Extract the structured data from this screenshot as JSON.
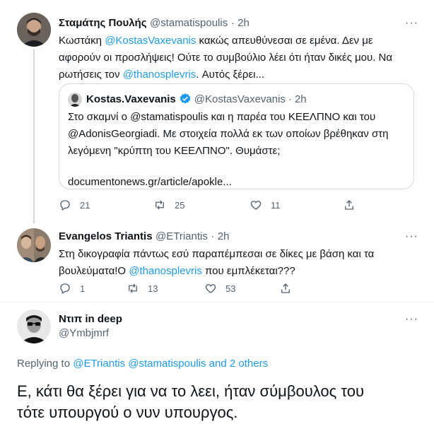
{
  "tweet1": {
    "name": "Σταμάτης Πουλής",
    "handle": "@stamatispoulis",
    "sep": "·",
    "time": "2h",
    "more": "···",
    "line1_a": "Κωστάκη ",
    "line1_mention": "@KostasVaxevanis",
    "line1_b": " κακώς απευθύνεσαι σε εμένα. Δεν με",
    "line2": "αφορούν οι προσλήψεις! Ούτε το συμβούλιο λέει ότι ήταν δικές μου. Να",
    "line3_a": "ρωτήσεις τον ",
    "line3_mention": "@thanosplevris",
    "line3_b": ". Αυτός ξέρει...",
    "quote": {
      "name": "Kostas.Vaxevanis",
      "handle": "@KostasVaxevanis",
      "sep": "·",
      "time": "2h",
      "line1": "Στο σκαμνί ο @stamatispoulis και η παρέα του ΚΕΕΛΠΝΟ και του",
      "line2": "@AdonisGeorgiadi. Με στοιχεία πολλά εκ των οποίων βρέθηκαν στη",
      "line3": "λεγόμενη \"κρύπτη του ΚΕΕΛΠΝΟ\". Θυμάστε;",
      "link": "documentonews.gr/article/apokle..."
    },
    "replies": "21",
    "retweets": "25",
    "likes": "11"
  },
  "tweet2": {
    "name": "Evangelos Triantis",
    "handle": "@ETriantis",
    "sep": "·",
    "time": "2h",
    "more": "···",
    "line1": "Στη δικογραφία πάντως εσύ παραπέμπεσαι σε δίκες με βάση και τα",
    "line2_a": "βουλεύματα!Ο ",
    "line2_mention": "@thanosplevris",
    "line2_b": " που εμπλέκεται???",
    "replies": "1",
    "retweets": "13",
    "likes": "53"
  },
  "tweet3": {
    "name": "Ντιπ in deep",
    "handle": "@Ymbjmrf",
    "more": "···",
    "replying_label": "Replying to ",
    "replying_mentions": "@ETriantis @stamatispoulis and 2 others",
    "line1": "Ε, κάτι θα ξέρει για να το λεει, ήταν σύμβουλος του",
    "line2": "τότε υπουργού ο νυν υπουργος."
  },
  "colors": {
    "accent": "#1d9bf0",
    "muted": "#536471",
    "verified": "#1d9bf0"
  }
}
